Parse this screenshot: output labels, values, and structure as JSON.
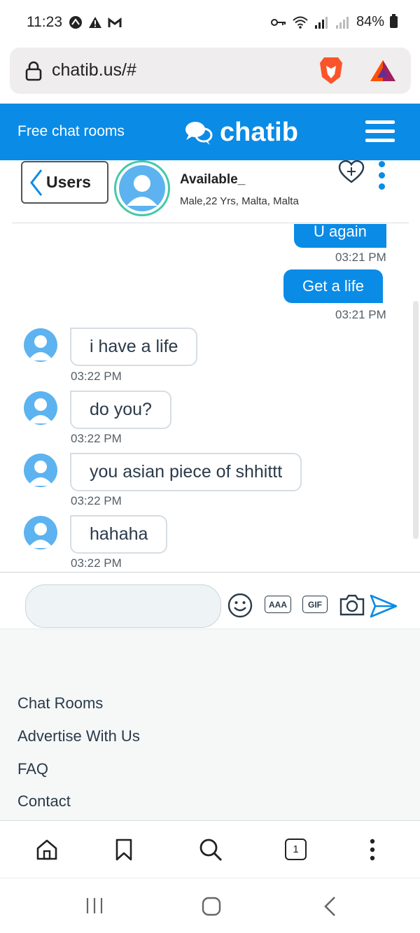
{
  "status_bar": {
    "time": "11:23",
    "battery": "84%"
  },
  "browser": {
    "url": "chatib.us/#"
  },
  "site": {
    "tagline": "Free chat rooms",
    "logo_text": "chatib",
    "brand_color": "#0a8be6"
  },
  "chat_header": {
    "back_label": "Users",
    "user_name": "Available_",
    "user_info": "Male,22 Yrs, Malta, Malta"
  },
  "messages": [
    {
      "direction": "outgoing",
      "text": "U again",
      "time": "03:21 PM"
    },
    {
      "direction": "outgoing",
      "text": "Get a life",
      "time": "03:21 PM"
    },
    {
      "direction": "incoming",
      "text": "i have a life",
      "time": "03:22 PM"
    },
    {
      "direction": "incoming",
      "text": "do you?",
      "time": "03:22 PM"
    },
    {
      "direction": "incoming",
      "text": "you asian piece of shhittt",
      "time": "03:22 PM"
    },
    {
      "direction": "incoming",
      "text": "hahaha",
      "time": "03:22 PM"
    }
  ],
  "composer": {
    "placeholder": "",
    "text_style_label": "AAA",
    "gif_label": "GIF"
  },
  "footer_links": [
    "Chat Rooms",
    "Advertise With Us",
    "FAQ",
    "Contact"
  ],
  "browser_nav": {
    "tab_count": "1"
  }
}
